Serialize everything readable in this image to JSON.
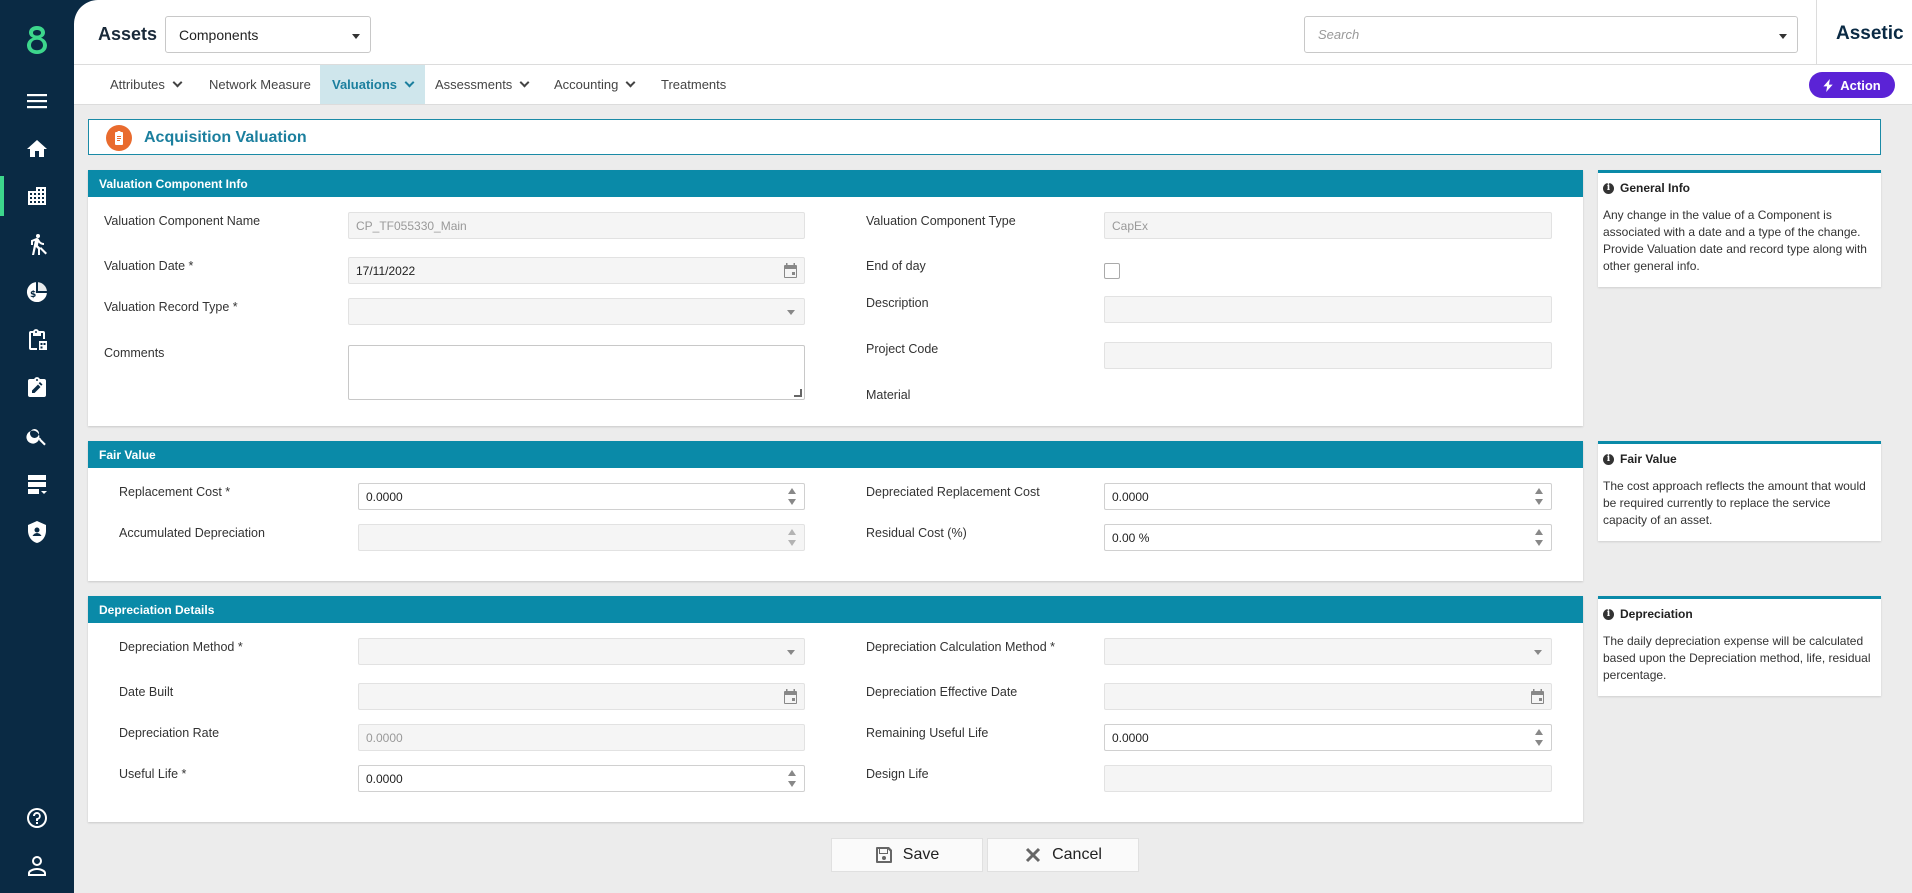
{
  "header": {
    "module_title": "Assets",
    "module_select": "Components",
    "search_placeholder": "Search",
    "brand": "Assetic"
  },
  "sidebar": {
    "icons": [
      "logo-icon",
      "menu-icon",
      "home-icon",
      "buildings-icon",
      "worker-icon",
      "finance-icon",
      "clipboard-icon",
      "task-icon",
      "search-icon",
      "server-icon",
      "security-icon",
      "help-icon",
      "user-icon"
    ]
  },
  "tabs": [
    {
      "label": "Attributes",
      "has_menu": true
    },
    {
      "label": "Network Measure",
      "has_menu": false
    },
    {
      "label": "Valuations",
      "has_menu": true,
      "active": true
    },
    {
      "label": "Assessments",
      "has_menu": true
    },
    {
      "label": "Accounting",
      "has_menu": true
    },
    {
      "label": "Treatments",
      "has_menu": false
    }
  ],
  "action_button": "Action",
  "page_title": "Acquisition Valuation",
  "valuation_info": {
    "heading": "Valuation Component Info",
    "component_name_label": "Valuation Component Name",
    "component_name_value": "CP_TF055330_Main",
    "component_type_label": "Valuation Component Type",
    "component_type_value": "CapEx",
    "date_label": "Valuation Date *",
    "date_value": "17/11/2022",
    "end_of_day_label": "End of day",
    "record_type_label": "Valuation Record Type *",
    "record_type_value": "",
    "description_label": "Description",
    "description_value": "",
    "comments_label": "Comments",
    "comments_value": "",
    "project_code_label": "Project Code",
    "project_code_value": "",
    "material_label": "Material"
  },
  "fair_value": {
    "heading": "Fair Value",
    "replacement_cost_label": "Replacement Cost *",
    "replacement_cost_value": "0.0000",
    "depreciated_replacement_cost_label": "Depreciated Replacement Cost",
    "depreciated_replacement_cost_value": "0.0000",
    "accumulated_depreciation_label": "Accumulated Depreciation",
    "accumulated_depreciation_value": "",
    "residual_cost_label": "Residual Cost (%)",
    "residual_cost_value": "0.00 %"
  },
  "depreciation": {
    "heading": "Depreciation Details",
    "method_label": "Depreciation Method *",
    "method_value": "",
    "calc_method_label": "Depreciation Calculation Method *",
    "calc_method_value": "",
    "date_built_label": "Date Built",
    "date_built_value": "",
    "effective_date_label": "Depreciation Effective Date",
    "effective_date_value": "",
    "rate_label": "Depreciation Rate",
    "rate_value": "0.0000",
    "remaining_life_label": "Remaining Useful Life",
    "remaining_life_value": "0.0000",
    "useful_life_label": "Useful Life *",
    "useful_life_value": "0.0000",
    "design_life_label": "Design Life",
    "design_life_value": ""
  },
  "info_cards": [
    {
      "title": "General Info",
      "body": "Any change in the value of a Component is associated with a date and a type of the change. Provide Valuation date and record type along with other general info."
    },
    {
      "title": "Fair Value",
      "body": "The cost approach reflects the amount that would be required currently to replace the service capacity of an asset."
    },
    {
      "title": "Depreciation",
      "body": "The daily depreciation expense will be calculated based upon the Depreciation method, life, residual percentage."
    }
  ],
  "footer": {
    "save_label": "Save",
    "cancel_label": "Cancel"
  },
  "colors": {
    "sidebar_bg": "#0a2a44",
    "accent_teal": "#0a8aa8",
    "active_tab_bg": "#cfe6ec",
    "action_purple": "#5b23d6",
    "sidebar_active": "#3dd68c",
    "title_icon_orange": "#e96b2e"
  }
}
